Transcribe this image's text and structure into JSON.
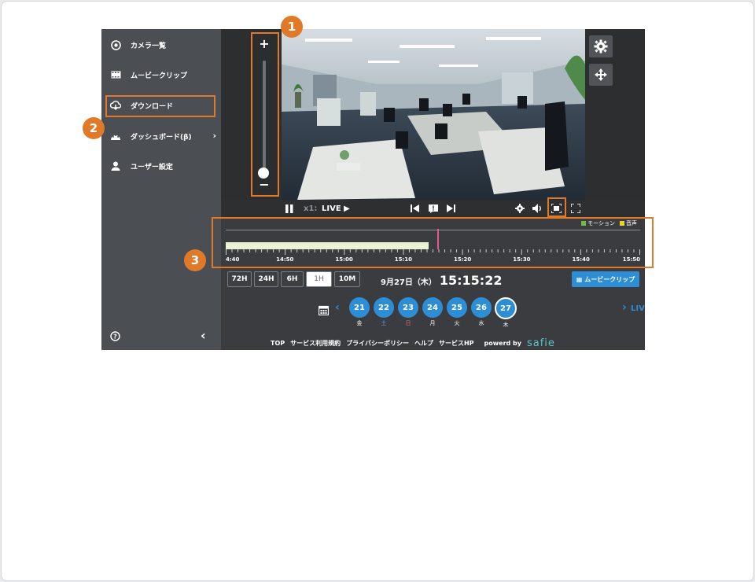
{
  "sidebar": {
    "items": [
      {
        "label": "カメラ一覧",
        "icon": "camera-icon"
      },
      {
        "label": "ムービークリップ",
        "icon": "film-icon"
      },
      {
        "label": "ダウンロード",
        "icon": "cloud-download-icon"
      },
      {
        "label": "ダッシュボード(β)",
        "icon": "dashboard-icon"
      },
      {
        "label": "ユーザー設定",
        "icon": "user-icon"
      }
    ],
    "help_icon": "help-icon",
    "collapse_icon": "chevron-left-icon"
  },
  "player": {
    "zoom_plus": "+",
    "zoom_minus": "−",
    "zoom_level": 0.0,
    "speed": "x1:",
    "live_label": "LIVE ▶"
  },
  "timeline": {
    "legend_motion": "モーション",
    "legend_audio": "音声",
    "motion_color": "#6bbf3f",
    "audio_color": "#e8d22a",
    "labels": [
      "4:40",
      "14:50",
      "15:00",
      "15:10",
      "15:20",
      "15:30",
      "15:40",
      "15:50"
    ],
    "recorded_fraction": 0.49,
    "cursor_fraction": 0.51
  },
  "range_buttons": [
    "72H",
    "24H",
    "6H",
    "1H",
    "10M"
  ],
  "range_selected": "1H",
  "date": {
    "day": "9月27日（木）",
    "time": "15:15:22"
  },
  "clip_button": "ムービークリップ",
  "days": [
    {
      "num": "21",
      "wd": "金",
      "color": "#ffffff"
    },
    {
      "num": "22",
      "wd": "土",
      "color": "#5aa9e6"
    },
    {
      "num": "23",
      "wd": "日",
      "color": "#e06a8c"
    },
    {
      "num": "24",
      "wd": "月",
      "color": "#ffffff"
    },
    {
      "num": "25",
      "wd": "火",
      "color": "#ffffff"
    },
    {
      "num": "26",
      "wd": "水",
      "color": "#ffffff"
    },
    {
      "num": "27",
      "wd": "木",
      "color": "#ffffff"
    }
  ],
  "days_live": "LIVE",
  "footer": {
    "links": [
      "TOP",
      "サービス利用規約",
      "プライバシーポリシー",
      "ヘルプ",
      "サービスHP"
    ],
    "powered": "powerd by",
    "brand": "safie"
  },
  "badges": [
    "1",
    "2",
    "3"
  ],
  "accent_color": "#e07a28"
}
